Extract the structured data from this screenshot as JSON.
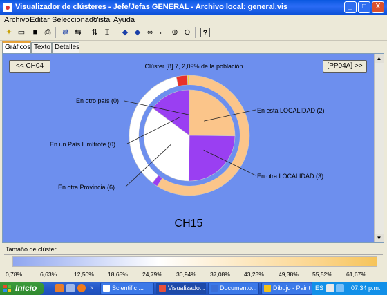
{
  "window": {
    "title": "Visualizador de clústeres - Jefe/Jefas GENERAL - Archivo local: general.vis",
    "minimize": "_",
    "maximize": "□",
    "close": "X"
  },
  "menu": [
    "Archivo",
    "Editar",
    "Seleccionado",
    "Vista",
    "Ayuda"
  ],
  "tabs": [
    "Gráficos",
    "Texto",
    "Detalles"
  ],
  "nav": {
    "prev": "<< CH04",
    "next": "[PP04A] >>"
  },
  "cluster_title": "Clúster [8] 7, 2,09% de la población",
  "cluster_name": "CH15",
  "colors": {
    "panel_bg": "#6d8fee",
    "orange": "#fbc58a",
    "purple": "#9a3ff2",
    "white": "#ffffff",
    "red": "#e8312a",
    "yellow": "#f6d33c"
  },
  "chart_data": {
    "type": "pie",
    "title": "",
    "inner_slices": [
      {
        "label": "En esta LOCALIDAD (2)",
        "value": 25.2
      },
      {
        "label": "En otra LOCALIDAD (3)",
        "value": 25.0
      },
      {
        "label": "En otra Provincia (6)",
        "value": 35.0
      },
      {
        "label": "En un País Limítrofe (0)",
        "value": 14.8
      },
      {
        "label": "En otro país (0)",
        "value": 0.0
      }
    ],
    "outer_slices": [
      {
        "category": "orange",
        "value": 59
      },
      {
        "category": "purple",
        "value": 1.5
      },
      {
        "category": "white",
        "value": 36
      },
      {
        "category": "red",
        "value": 3
      },
      {
        "category": "yellow",
        "value": 0.5
      }
    ]
  },
  "legend": {
    "label": "Tamaño de clúster",
    "ticks": [
      "0,78%",
      "6,63%",
      "12,50%",
      "18,65%",
      "24,79%",
      "30,94%",
      "37,08%",
      "43,23%",
      "49,38%",
      "55,52%",
      "61,67%"
    ]
  },
  "taskbar": {
    "start": "Inicio",
    "tasks": [
      "Scientific ...",
      "Visualizado...",
      "Documento...",
      "Dibujo - Paint"
    ],
    "lang": "ES",
    "clock": "07:34 p.m."
  }
}
